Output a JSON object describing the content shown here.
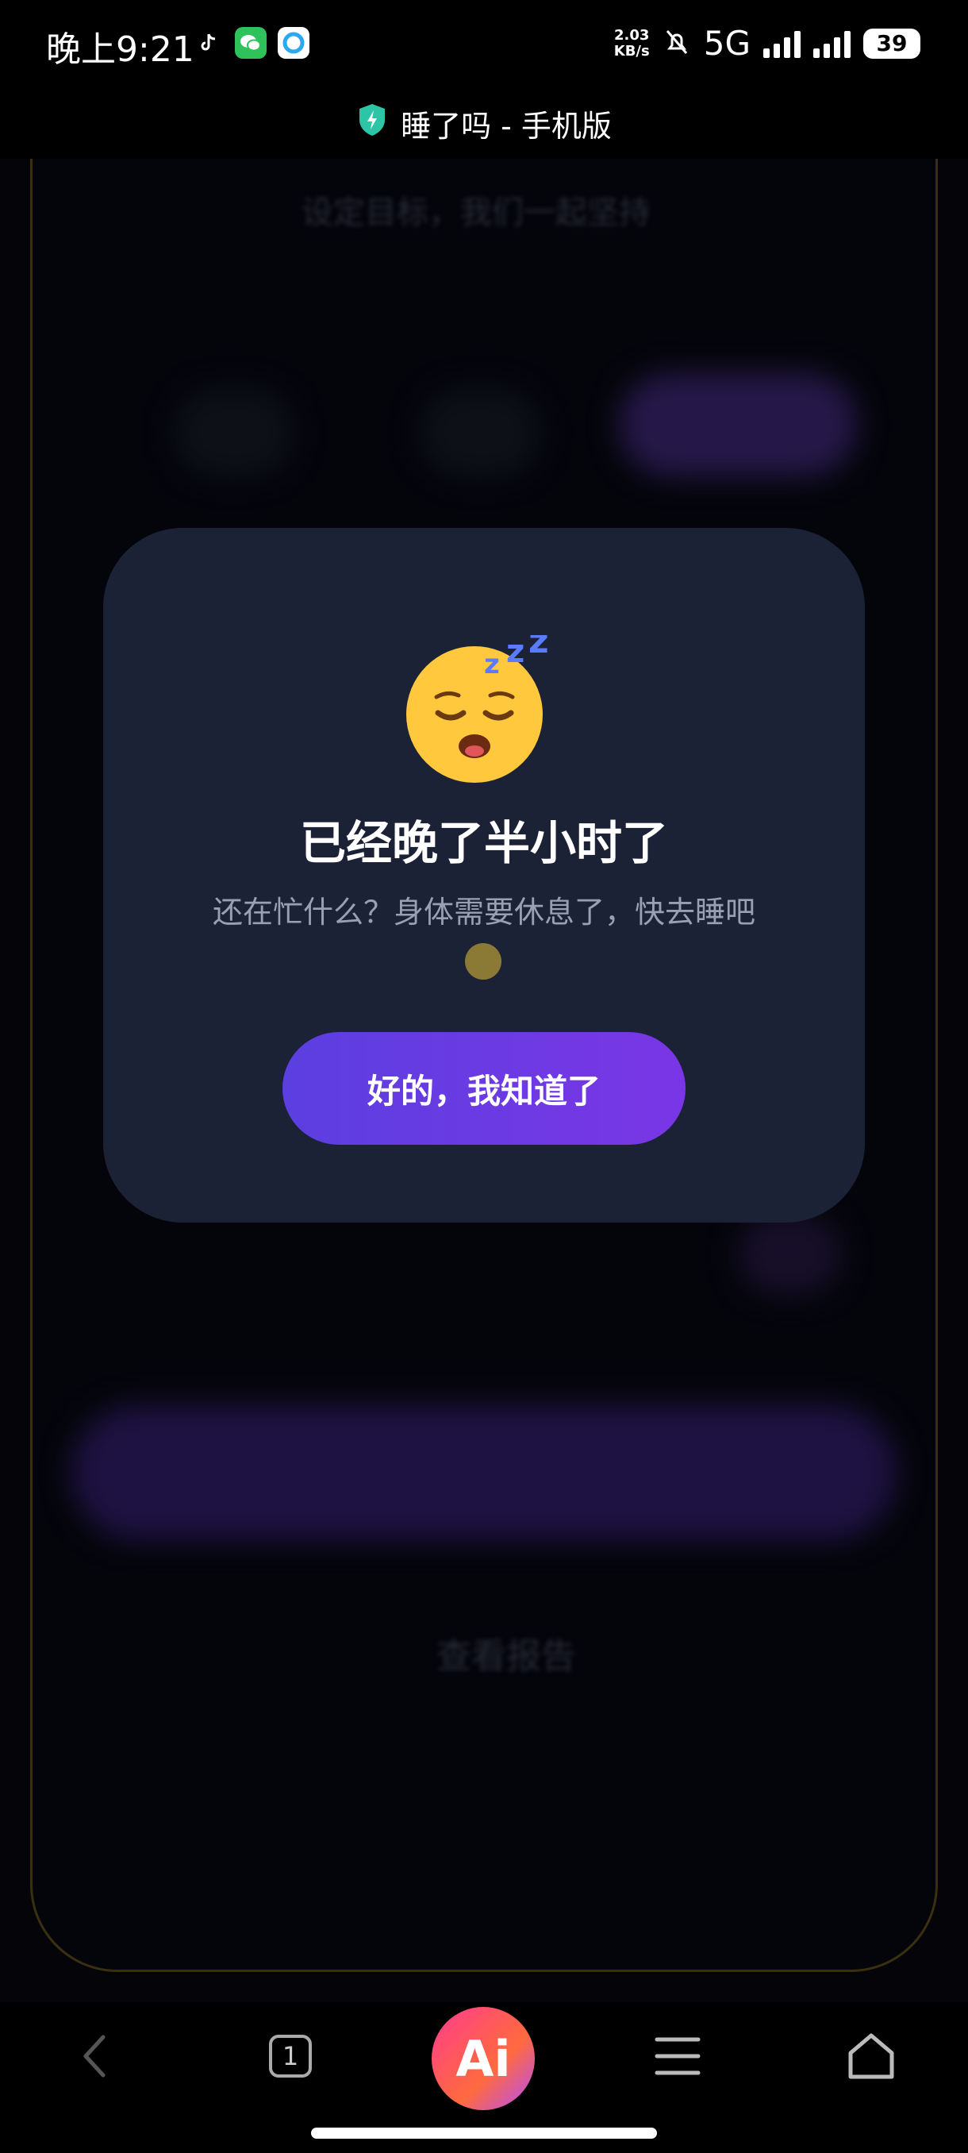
{
  "status_bar": {
    "time": "晚上9:21",
    "net_speed_value": "2.03",
    "net_speed_unit": "KB/s",
    "network": "5G",
    "battery": "39"
  },
  "browser": {
    "title": "睡了吗 - 手机版"
  },
  "background_page": {
    "hint_text": "设定目标，我们一起坚持",
    "report_label": "查看报告"
  },
  "dialog": {
    "emoji": "😴",
    "title": "已经晚了半小时了",
    "message": "还在忙什么？身体需要休息了，快去睡吧",
    "confirm_label": "好的，我知道了"
  },
  "navbar": {
    "tab_count": "1",
    "ai_label": "Ai"
  },
  "colors": {
    "dialog_bg": "#1c2236",
    "button_start": "#5b3fe0",
    "button_end": "#7a36e6"
  }
}
